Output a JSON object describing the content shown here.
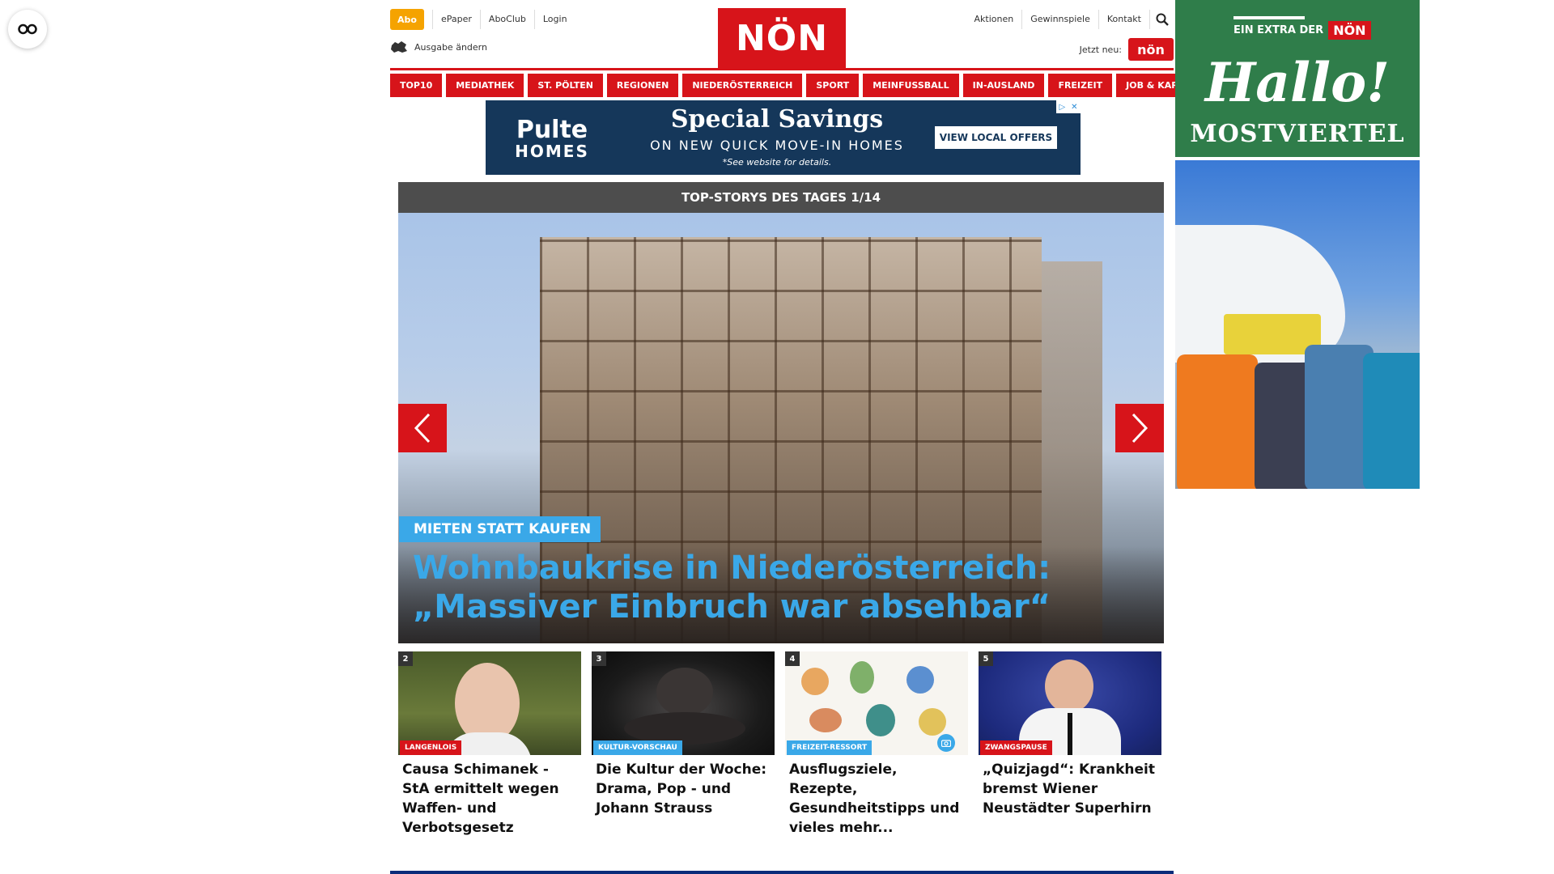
{
  "a11y": {
    "icon": "accessibility-toggle-icon"
  },
  "header": {
    "abo_label": "Abo",
    "top_links": [
      "ePaper",
      "AboClub",
      "Login"
    ],
    "ausgabe_label": "Ausgabe ändern",
    "logo_text": "NÖN",
    "right_links": [
      "Aktionen",
      "Gewinnspiele",
      "Kontakt"
    ],
    "jetzt_label": "Jetzt neu:",
    "jetzt_badge": "nön"
  },
  "nav": {
    "items": [
      "TOP10",
      "MEDIATHEK",
      "ST. PÖLTEN",
      "REGIONEN",
      "NIEDERÖSTERREICH",
      "SPORT",
      "MEINFUSSBALL",
      "IN-AUSLAND",
      "FREIZEIT",
      "JOB & KARRIERE"
    ]
  },
  "ad_top": {
    "brand_1": "Pulte",
    "brand_2": "HOMES",
    "headline": "Special Savings",
    "sub": "ON NEW QUICK MOVE-IN HOMES",
    "fine": "*See website for details.",
    "cta": "VIEW LOCAL OFFERS"
  },
  "slider": {
    "heading": "TOP-STORYS DES TAGES 1/14",
    "kicker": "MIETEN STATT KAUFEN",
    "title": "Wohnbaukrise in Niederösterreich: „Massiver Einbruch war absehbar“"
  },
  "teasers": [
    {
      "num": "2",
      "tag": "LANGENLOIS",
      "tag_color": "#d7141a",
      "title": "Causa Schimanek - StA ermittelt wegen Waffen- und Verbotsgesetz"
    },
    {
      "num": "3",
      "tag": "KULTUR-VORSCHAU",
      "tag_color": "#3aa8e8",
      "title": "Die Kultur der Woche: Drama, Pop - und Johann Strauss"
    },
    {
      "num": "4",
      "tag": "FREIZEIT-RESSORT",
      "tag_color": "#3aa8e8",
      "title": "Ausflugsziele, Rezepte, Gesundheitstipps und vieles mehr..."
    },
    {
      "num": "5",
      "tag": "ZWANGSPAUSE",
      "tag_color": "#d7141a",
      "title": "„Quizjagd“: Krankheit bremst Wiener Neustädter Superhirn"
    }
  ],
  "ad_right": {
    "extra": "EIN EXTRA DER",
    "noen": "NÖN",
    "hallo": "Hallo!",
    "region": "MOSTVIERTEL"
  },
  "colors": {
    "brand_red": "#d7141a",
    "accent_blue": "#3aa8e8",
    "abo_orange": "#f5a300"
  }
}
